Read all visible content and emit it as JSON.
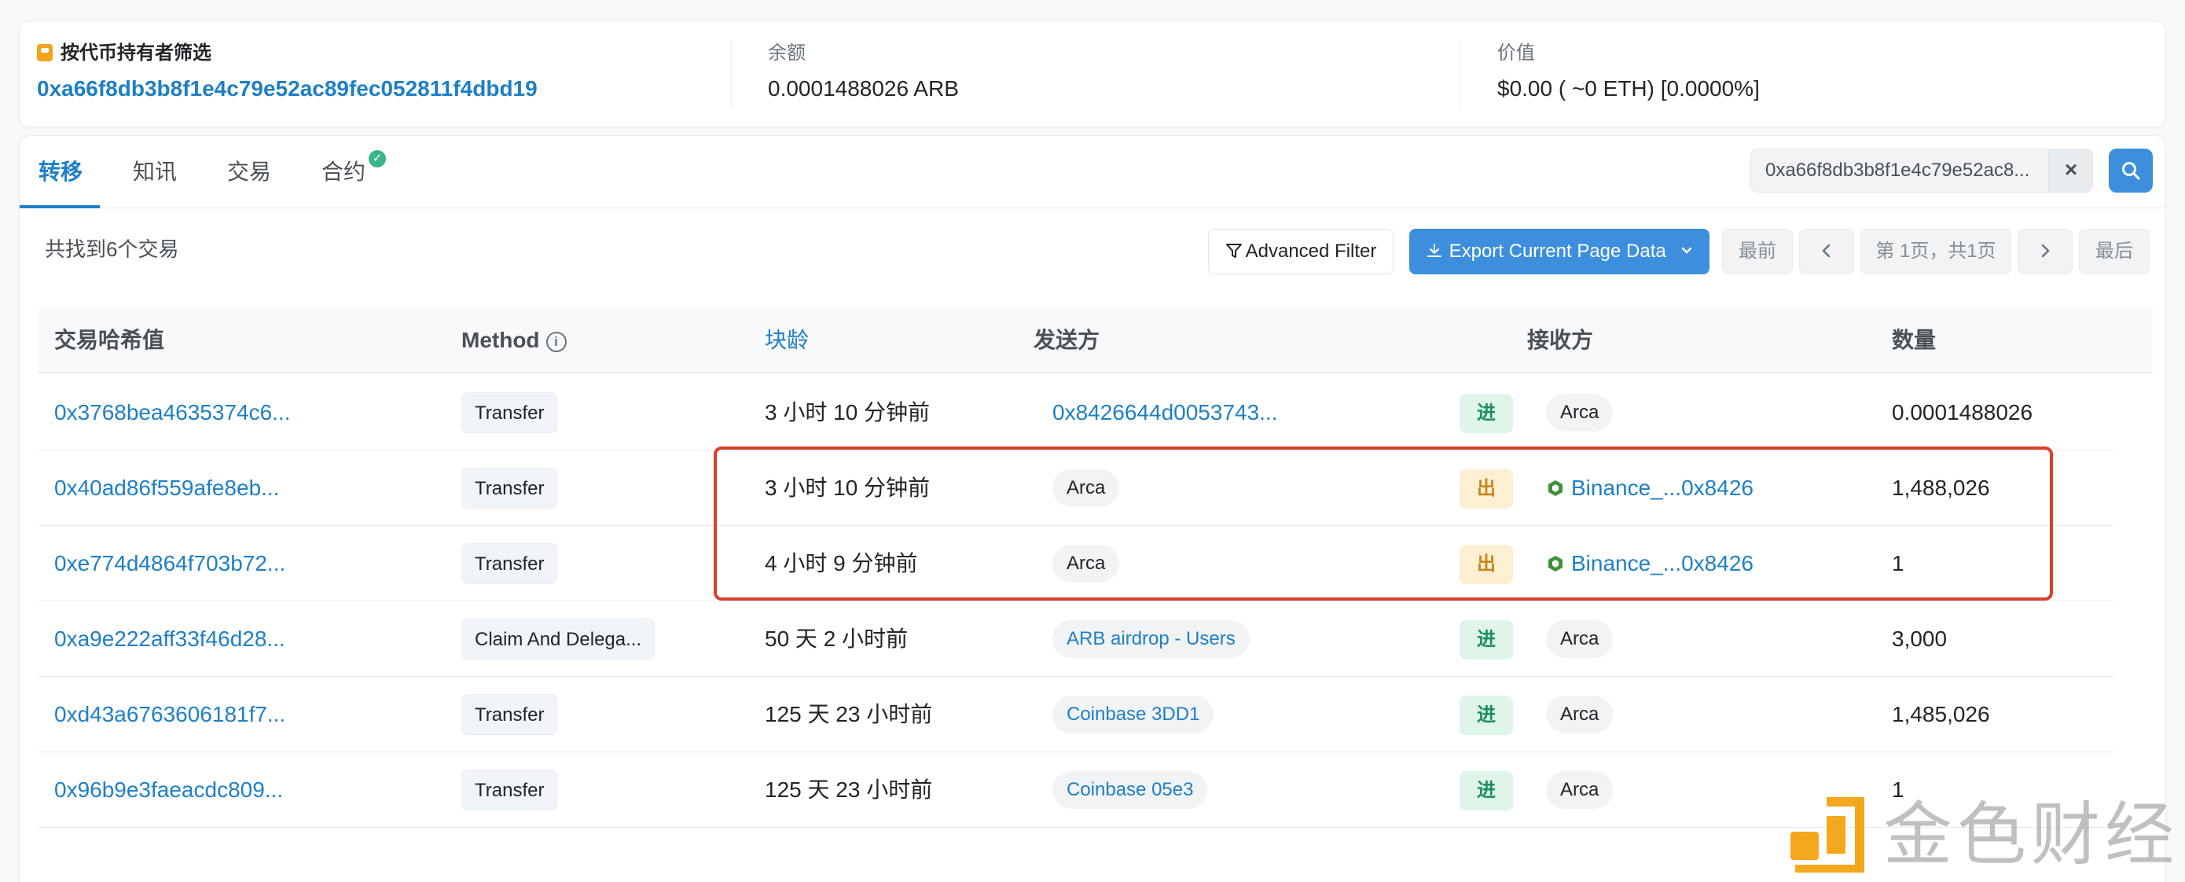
{
  "summary": {
    "holder_label": "按代币持有者筛选",
    "holder_address": "0xa66f8db3b8f1e4c79e52ac89fec052811f4dbd19",
    "balance_label": "余额",
    "balance_value": "0.0001488026 ARB",
    "value_label": "价值",
    "value_value": "$0.00 ( ~0 ETH) [0.0000%]"
  },
  "tabs": [
    {
      "label": "转移",
      "active": true
    },
    {
      "label": "知讯",
      "active": false
    },
    {
      "label": "交易",
      "active": false
    },
    {
      "label": "合约",
      "active": false,
      "verified": true
    }
  ],
  "search": {
    "value": "0xa66f8db3b8f1e4c79e52ac8...",
    "clear_label": "×"
  },
  "toolbar": {
    "found_text": "共找到6个交易",
    "advanced_filter": "Advanced Filter",
    "export": "Export Current Page Data",
    "first": "最前",
    "page_info": "第 1页，共1页",
    "last": "最后"
  },
  "table": {
    "columns": [
      "交易哈希值",
      "Method",
      "块龄",
      "发送方",
      "接收方",
      "数量"
    ],
    "rows": [
      {
        "hash": "0x3768bea4635374c6...",
        "method": "Transfer",
        "age": "3 小时 10 分钟前",
        "from": "0x8426644d0053743...",
        "from_style": "link",
        "dir": "进",
        "dir_type": "in",
        "to": "Arca",
        "to_style": "pill",
        "amount": "0.0001488026"
      },
      {
        "hash": "0x40ad86f559afe8eb...",
        "method": "Transfer",
        "age": "3 小时 10 分钟前",
        "from": "Arca",
        "from_style": "pill",
        "dir": "出",
        "dir_type": "out",
        "to": "Binance_...0x8426",
        "to_style": "link-icon",
        "amount": "1,488,026"
      },
      {
        "hash": "0xe774d4864f703b72...",
        "method": "Transfer",
        "age": "4 小时 9 分钟前",
        "from": "Arca",
        "from_style": "pill",
        "dir": "出",
        "dir_type": "out",
        "to": "Binance_...0x8426",
        "to_style": "link-icon",
        "amount": "1"
      },
      {
        "hash": "0xa9e222aff33f46d28...",
        "method": "Claim And Delega...",
        "age": "50 天 2 小时前",
        "from": "ARB airdrop - Users",
        "from_style": "pill-link",
        "dir": "进",
        "dir_type": "in",
        "to": "Arca",
        "to_style": "pill",
        "amount": "3,000"
      },
      {
        "hash": "0xd43a6763606181f7...",
        "method": "Transfer",
        "age": "125 天 23 小时前",
        "from": "Coinbase 3DD1",
        "from_style": "pill-link",
        "dir": "进",
        "dir_type": "in",
        "to": "Arca",
        "to_style": "pill",
        "amount": "1,485,026"
      },
      {
        "hash": "0x96b9e3faeacdc809...",
        "method": "Transfer",
        "age": "125 天 23 小时前",
        "from": "Coinbase 05e3",
        "from_style": "pill-link",
        "dir": "进",
        "dir_type": "in",
        "to": "Arca",
        "to_style": "pill",
        "amount": "1"
      }
    ]
  },
  "watermark": {
    "text": "金色财经"
  },
  "colors": {
    "accent": "#1e7fc6",
    "primary_button": "#3d8fdd",
    "in_badge": "#1c8f5a",
    "out_badge": "#c7851a",
    "highlight": "#d8402a"
  }
}
